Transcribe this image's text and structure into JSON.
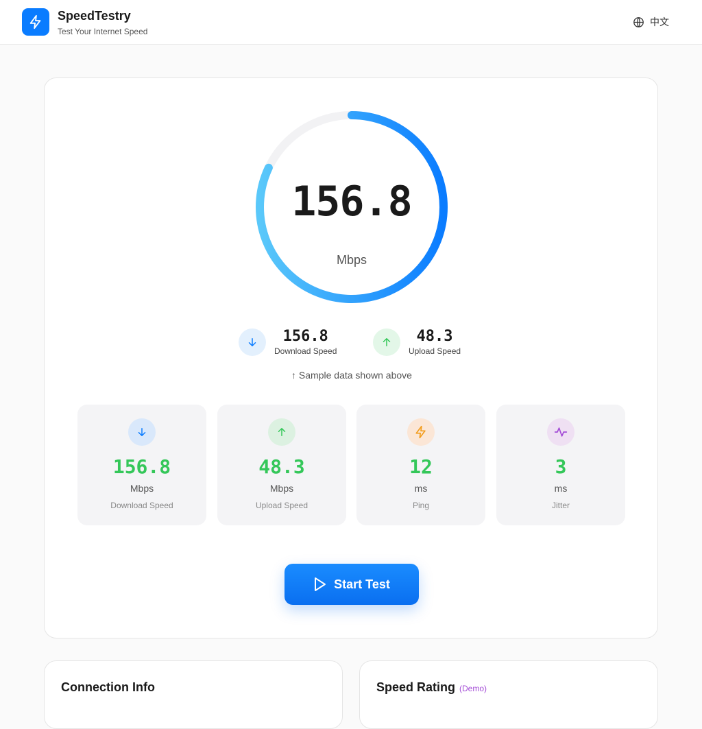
{
  "header": {
    "app_name": "SpeedTestry",
    "tagline": "Test Your Internet Speed",
    "language_label": "中文",
    "accent_color": "#0a7cff"
  },
  "gauge": {
    "value": "156.8",
    "unit": "Mbps",
    "progress_fraction": 0.82
  },
  "summary": {
    "download": {
      "value": "156.8",
      "label": "Download Speed"
    },
    "upload": {
      "value": "48.3",
      "label": "Upload Speed"
    },
    "note": "↑ Sample data shown above"
  },
  "stats": [
    {
      "value": "156.8",
      "unit": "Mbps",
      "label": "Download Speed",
      "icon": "arrow-down-icon"
    },
    {
      "value": "48.3",
      "unit": "Mbps",
      "label": "Upload Speed",
      "icon": "arrow-up-icon"
    },
    {
      "value": "12",
      "unit": "ms",
      "label": "Ping",
      "icon": "lightning-icon"
    },
    {
      "value": "3",
      "unit": "ms",
      "label": "Jitter",
      "icon": "activity-icon"
    }
  ],
  "start_button": {
    "label": "Start Test"
  },
  "panels": {
    "connection": {
      "title": "Connection Info"
    },
    "rating": {
      "title": "Speed Rating",
      "badge": "(Demo)"
    }
  }
}
